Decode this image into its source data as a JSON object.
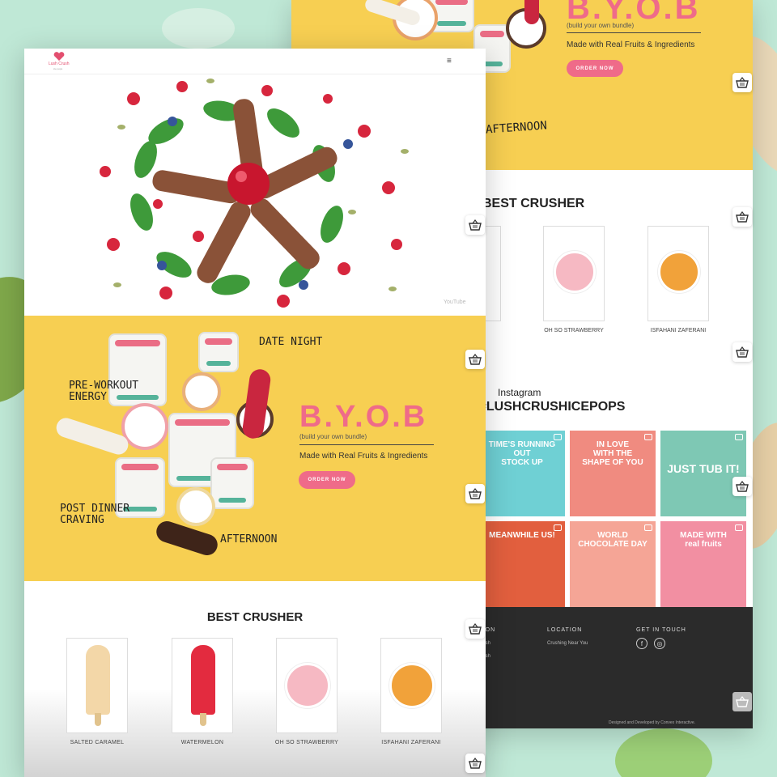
{
  "front": {
    "nav": {
      "logo_text": "Lush Crush",
      "logo_sub": "ice pops",
      "menu_icon": "hamburger-icon",
      "menu_glyph": "≡"
    },
    "hero": {
      "watermark": "YouTube"
    },
    "byob": {
      "title": "B.Y.O.B",
      "subtitle": "(build your own bundle)",
      "tagline": "Made with Real Fruits & Ingredients",
      "order_button": "ORDER NOW",
      "labels": {
        "date_night": "DATE NIGHT",
        "pre_workout": "PRE-WORKOUT\nENERGY",
        "post_dinner": "POST DINNER\nCRAVING",
        "afternoon": "AFTERNOON"
      }
    },
    "best_crusher": {
      "title": "BEST CRUSHER",
      "products": [
        {
          "name": "SALTED CARAMEL"
        },
        {
          "name": "WATERMELON"
        },
        {
          "name": "OH SO STRAWBERRY"
        },
        {
          "name": "ISFAHANI ZAFERANI"
        }
      ]
    }
  },
  "back": {
    "byob": {
      "title": "B.Y.O.B",
      "subtitle": "(build your own bundle)",
      "tagline": "Made with Real Fruits & Ingredients",
      "order_button": "ORDER NOW",
      "afternoon": "AFTERNOON"
    },
    "best_crusher": {
      "title": "BEST CRUSHER",
      "products": [
        {
          "name": "OH SO STRAWBERRY"
        },
        {
          "name": "ISFAHANI ZAFERANI"
        }
      ]
    },
    "instagram": {
      "label": "Instagram",
      "handle": "#LUSHCRUSHICEPOPS",
      "tiles": [
        {
          "text": "TIME'S RUNNING OUT\nSTOCK UP",
          "color": "#6fd0d4"
        },
        {
          "text": "IN LOVE\nWITH THE\nSHAPE OF YOU",
          "color": "#f08b80"
        },
        {
          "text": "JUST TUB IT!",
          "color": "#7ec8b4"
        },
        {
          "text": "MEANWHILE US!",
          "color": "#e25f3e"
        },
        {
          "text": "WORLD CHOCOLATE DAY",
          "color": "#f5a596"
        },
        {
          "text": "MADE WITH\nreal fruits",
          "color": "#f28fa2"
        }
      ]
    },
    "footer": {
      "col1_heading": "NAVIGATION",
      "col1_links": [
        "Crush",
        "Crush"
      ],
      "col2_heading": "LOCATION",
      "col2_link": "Crushing Near You",
      "col3_heading": "GET IN TOUCH",
      "facebook_glyph": "f",
      "instagram_glyph": "◎",
      "credit": "Designed and Developed by Convex Interactive."
    }
  },
  "icons": {
    "cart": "basket-icon"
  },
  "colors": {
    "accent_pink": "#ef6b89",
    "yellow": "#f7cf52",
    "footer_dark": "#2b2b2b",
    "mint_bg": "#bfe8d6"
  }
}
